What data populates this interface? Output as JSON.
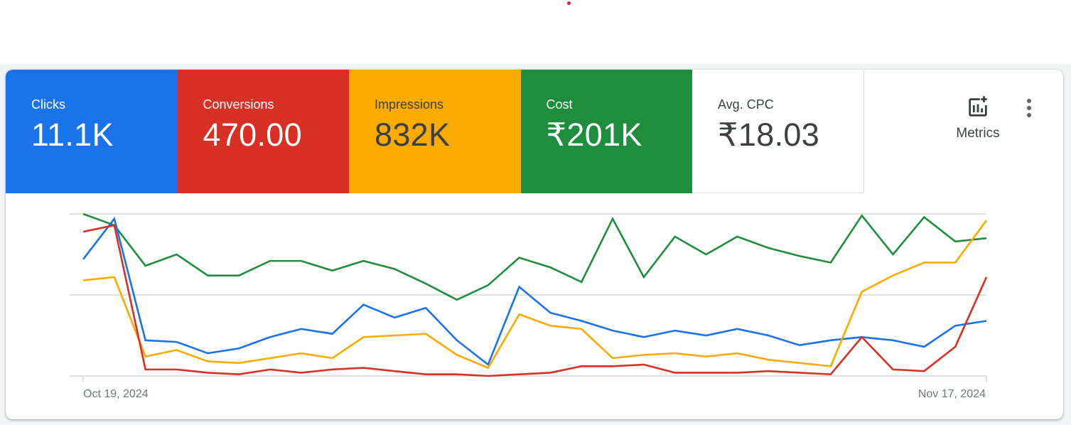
{
  "scorecards": [
    {
      "id": "clicks",
      "label": "Clicks",
      "value": "11.1K",
      "bg": "#1a73e8",
      "fg": "#ffffff"
    },
    {
      "id": "conversions",
      "label": "Conversions",
      "value": "470.00",
      "bg": "#d93025",
      "fg": "#ffffff"
    },
    {
      "id": "impressions",
      "label": "Impressions",
      "value": "832K",
      "bg": "#f9ab00",
      "fg": "#3c4043"
    },
    {
      "id": "cost",
      "label": "Cost",
      "value": "₹201K",
      "bg": "#1e8e3e",
      "fg": "#ffffff"
    },
    {
      "id": "avg-cpc",
      "label": "Avg. CPC",
      "value": "₹18.03",
      "bg": "#ffffff",
      "fg": "#3c4043"
    }
  ],
  "toolbar": {
    "metrics_label": "Metrics",
    "metrics_icon": "add-chart-icon",
    "more_icon": "more-vert-icon"
  },
  "chart_data": {
    "type": "line",
    "title": "",
    "xlabel": "",
    "ylabel": "",
    "x_range": [
      "Oct 19, 2024",
      "Nov 17, 2024"
    ],
    "x_tick_labels": [
      "Oct 19, 2024",
      "Nov 17, 2024"
    ],
    "y_units": "normalized per-series scale (0 = bottom gridline, 100 = top gridline); axes unlabeled",
    "ylim": [
      0,
      100
    ],
    "grid": true,
    "legend": "none (scorecard tiles act as legend)",
    "x": [
      "Oct 19",
      "Oct 20",
      "Oct 21",
      "Oct 22",
      "Oct 23",
      "Oct 24",
      "Oct 25",
      "Oct 26",
      "Oct 27",
      "Oct 28",
      "Oct 29",
      "Oct 30",
      "Oct 31",
      "Nov 1",
      "Nov 2",
      "Nov 3",
      "Nov 4",
      "Nov 5",
      "Nov 6",
      "Nov 7",
      "Nov 8",
      "Nov 9",
      "Nov 10",
      "Nov 11",
      "Nov 12",
      "Nov 13",
      "Nov 14",
      "Nov 15",
      "Nov 16",
      "Nov 17"
    ],
    "series": [
      {
        "name": "Cost",
        "color": "#1e8e3e",
        "values": [
          100,
          93,
          68,
          75,
          62,
          62,
          71,
          71,
          65,
          71,
          66,
          57,
          47,
          56,
          73,
          67,
          58,
          97,
          61,
          86,
          75,
          86,
          79,
          74,
          70,
          99,
          75,
          98,
          83,
          85
        ]
      },
      {
        "name": "Clicks",
        "color": "#1a73e8",
        "values": [
          72,
          97,
          22,
          21,
          14,
          17,
          24,
          29,
          26,
          44,
          36,
          42,
          22,
          7,
          55,
          39,
          34,
          28,
          24,
          28,
          25,
          29,
          25,
          19,
          22,
          24,
          22,
          18,
          31,
          34
        ]
      },
      {
        "name": "Impressions",
        "color": "#f9ab00",
        "values": [
          59,
          61,
          12,
          16,
          9,
          8,
          11,
          14,
          11,
          24,
          25,
          26,
          13,
          5,
          38,
          31,
          29,
          11,
          13,
          14,
          12,
          14,
          10,
          8,
          6,
          52,
          62,
          70,
          70,
          96
        ]
      },
      {
        "name": "Conversions",
        "color": "#d93025",
        "values": [
          89,
          93,
          4,
          4,
          2,
          1,
          4,
          2,
          4,
          5,
          3,
          1,
          1,
          0,
          1,
          2,
          6,
          6,
          7,
          2,
          2,
          2,
          3,
          2,
          1,
          24,
          4,
          3,
          18,
          61
        ]
      }
    ]
  }
}
